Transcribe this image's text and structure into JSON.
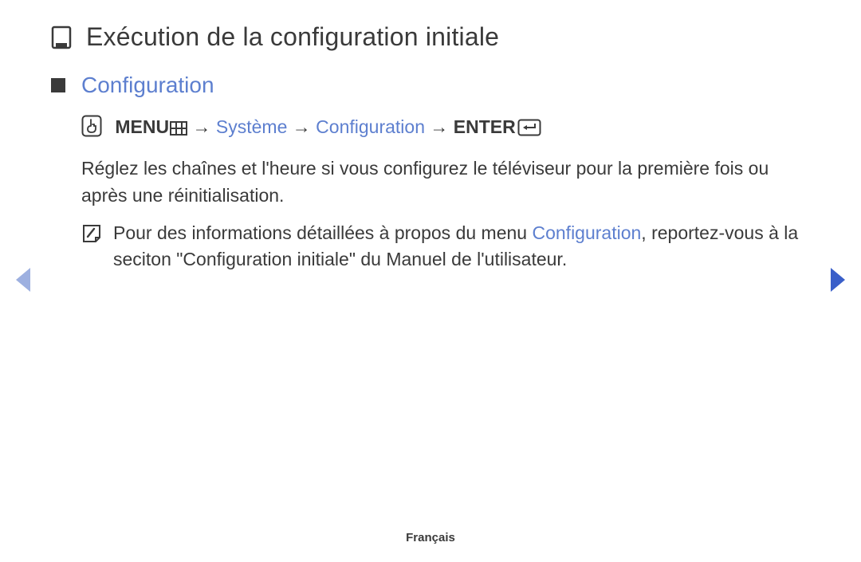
{
  "page": {
    "title": "Exécution de la configuration initiale"
  },
  "section": {
    "heading": "Configuration"
  },
  "nav_path": {
    "menu_label": "MENU",
    "arrow": "→",
    "step1": "Système",
    "step2": "Configuration",
    "enter_label": "ENTER"
  },
  "body": {
    "paragraph": "Réglez les chaînes et l'heure si vous configurez le téléviseur pour la première fois ou après une réinitialisation."
  },
  "note": {
    "prefix": "Pour des informations détaillées à propos du menu ",
    "highlight": "Configuration",
    "suffix": ", reportez-vous à la seciton \"Configuration initiale\" du Manuel de l'utilisateur."
  },
  "footer": {
    "language": "Français"
  }
}
